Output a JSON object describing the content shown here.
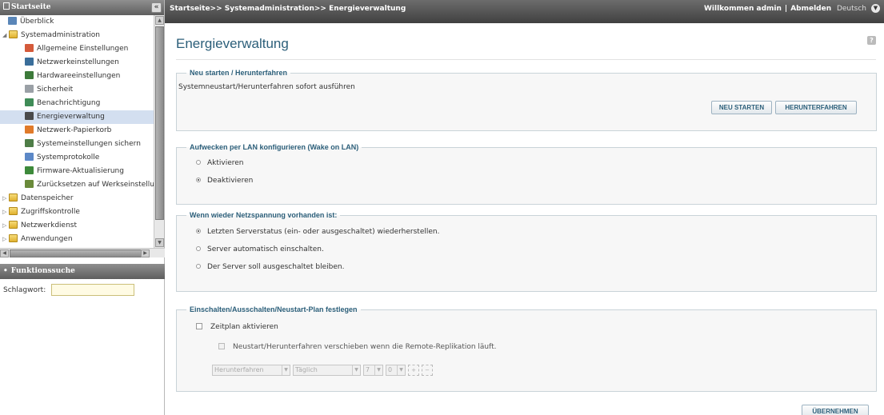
{
  "sidebar": {
    "title": "Startseite",
    "tree": [
      {
        "label": "Überblick",
        "level": 0,
        "icon": "overview-icon",
        "color": "#5a86b8"
      },
      {
        "label": "Systemadministration",
        "level": 0,
        "icon": "folder-icon",
        "expanded": true
      },
      {
        "label": "Allgemeine Einstellungen",
        "level": 1,
        "icon": "general-settings-icon",
        "color": "#d45a3a"
      },
      {
        "label": "Netzwerkeinstellungen",
        "level": 1,
        "icon": "network-settings-icon",
        "color": "#3a6e9a"
      },
      {
        "label": "Hardwareeinstellungen",
        "level": 1,
        "icon": "hardware-settings-icon",
        "color": "#3d7a3a"
      },
      {
        "label": "Sicherheit",
        "level": 1,
        "icon": "security-icon",
        "color": "#9aa0a6"
      },
      {
        "label": "Benachrichtigung",
        "level": 1,
        "icon": "notification-icon",
        "color": "#3f8c57"
      },
      {
        "label": "Energieverwaltung",
        "level": 1,
        "icon": "power-management-icon",
        "color": "#4a4a4a",
        "selected": true
      },
      {
        "label": "Netzwerk-Papierkorb",
        "level": 1,
        "icon": "recycle-bin-icon",
        "color": "#e07a2a"
      },
      {
        "label": "Systemeinstellungen sichern",
        "level": 1,
        "icon": "backup-settings-icon",
        "color": "#4e7d47"
      },
      {
        "label": "Systemprotokolle",
        "level": 1,
        "icon": "system-logs-icon",
        "color": "#5c88c7"
      },
      {
        "label": "Firmware-Aktualisierung",
        "level": 1,
        "icon": "firmware-icon",
        "color": "#3d8a3a"
      },
      {
        "label": "Zurücksetzen auf Werkseinstellu",
        "level": 1,
        "icon": "factory-reset-icon",
        "color": "#6a8a3a"
      },
      {
        "label": "Datenspeicher",
        "level": 0,
        "icon": "folder-icon"
      },
      {
        "label": "Zugriffskontrolle",
        "level": 0,
        "icon": "folder-icon"
      },
      {
        "label": "Netzwerkdienst",
        "level": 0,
        "icon": "folder-icon"
      },
      {
        "label": "Anwendungen",
        "level": 0,
        "icon": "folder-icon"
      }
    ],
    "search": {
      "title": "Funktionssuche",
      "label": "Schlagwort:",
      "value": ""
    }
  },
  "header": {
    "breadcrumb": "Startseite>> Systemadministration>> Energieverwaltung",
    "welcome": "Willkommen admin",
    "separator": "|",
    "logout": "Abmelden",
    "language": "Deutsch"
  },
  "main": {
    "title": "Energieverwaltung",
    "restart_section": {
      "legend": "Neu starten / Herunterfahren",
      "description": "Systemneustart/Herunterfahren sofort ausführen",
      "restart_button": "NEU STARTEN",
      "shutdown_button": "HERUNTERFAHREN"
    },
    "wol_section": {
      "legend": "Aufwecken per LAN konfigurieren (Wake on LAN)",
      "option_enable": "Aktivieren",
      "option_disable": "Deaktivieren",
      "selected": "disable"
    },
    "power_recovery_section": {
      "legend": "Wenn wieder Netzspannung vorhanden ist:",
      "option_restore": "Letzten Serverstatus (ein- oder ausgeschaltet) wiederherstellen.",
      "option_on": "Server automatisch einschalten.",
      "option_off": "Der Server soll ausgeschaltet bleiben.",
      "selected": "restore"
    },
    "schedule_section": {
      "legend": "Einschalten/Ausschalten/Neustart-Plan festlegen",
      "enable_schedule": "Zeitplan aktivieren",
      "enable_checked": false,
      "postpone_label": "Neustart/Herunterfahren verschieben wenn die Remote-Replikation läuft.",
      "postpone_checked": false,
      "action_value": "Herunterfahren",
      "frequency_value": "Täglich",
      "hour_value": "7",
      "minute_value": "0"
    },
    "apply_button": "ÜBERNEHMEN"
  },
  "colors": {
    "accent": "#2c5f7a",
    "topbar": "#404040",
    "selected_row": "#d3dff0"
  }
}
